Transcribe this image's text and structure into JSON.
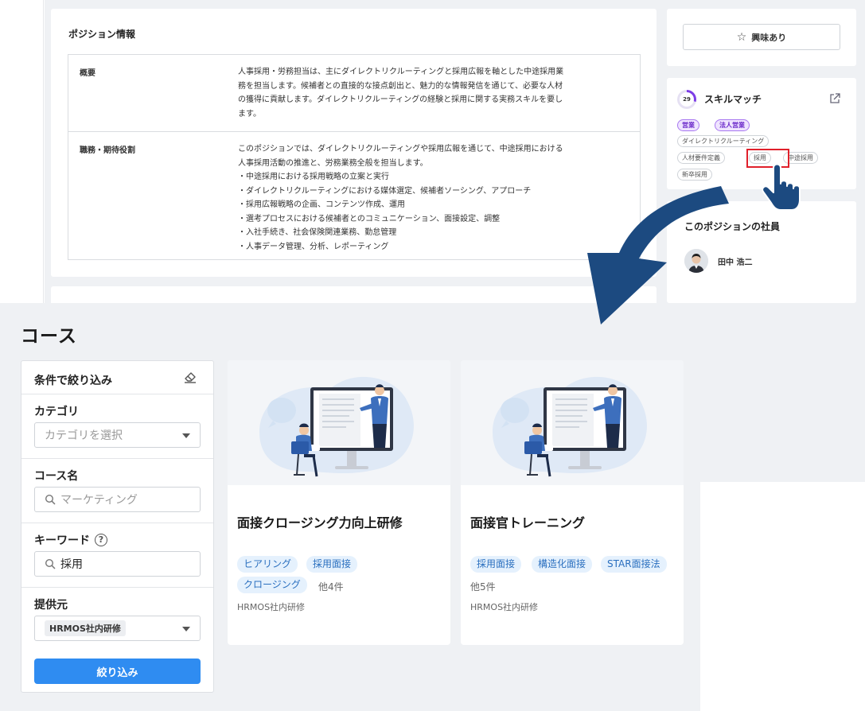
{
  "position": {
    "title": "ポジション情報",
    "rows": [
      {
        "label": "概要",
        "lines": [
          "人事採用・労務担当は、主にダイレクトリクルーティングと採用広報を軸とした中途採用業",
          "務を担当します。候補者との直接的な接点創出と、魅力的な情報発信を通じて、必要な人材",
          "の獲得に貢献します。ダイレクトリクルーティングの経験と採用に関する実務スキルを要し",
          "ます。"
        ]
      },
      {
        "label": "職務・期待役割",
        "lines": [
          "このポジションでは、ダイレクトリクルーティングや採用広報を通じて、中途採用における",
          "人事採用活動の推進と、労務業務全般を担当します。",
          "・中途採用における採用戦略の立案と実行",
          "・ダイレクトリクルーティングにおける媒体選定、候補者ソーシング、アプローチ",
          "・採用広報戦略の企画、コンテンツ作成、運用",
          "・選考プロセスにおける候補者とのコミュニケーション、面接設定、調整",
          "・入社手続き、社会保険関連業務、勤怠管理",
          "・人事データ管理、分析、レポーティング"
        ]
      }
    ]
  },
  "interest": {
    "label": "興味あり",
    "icon": "star-icon"
  },
  "skill_match": {
    "score": "29",
    "score_fraction": 0.29,
    "title": "スキルマッチ",
    "tags": [
      {
        "label": "営業",
        "highlight": true
      },
      {
        "label": "法人営業",
        "highlight": true
      },
      {
        "label": "ダイレクトリクルーティング",
        "highlight": false
      },
      {
        "label": "人材要件定義",
        "highlight": false
      },
      {
        "label": "採用",
        "highlight": false
      },
      {
        "label": "中途採用",
        "highlight": false
      },
      {
        "label": "新卒採用",
        "highlight": false
      }
    ]
  },
  "members": {
    "title": "このポジションの社員",
    "name": "田中 浩二"
  },
  "courses_page": {
    "title": "コース",
    "filter": {
      "header": "条件で絞り込み",
      "category_label": "カテゴリ",
      "category_placeholder": "カテゴリを選択",
      "course_name_label": "コース名",
      "course_name_placeholder": "マーケティング",
      "keyword_label": "キーワード",
      "keyword_value": "採用",
      "provider_label": "提供元",
      "provider_value": "HRMOS社内研修",
      "apply_label": "絞り込み"
    },
    "courses": [
      {
        "title": "面接クロージング力向上研修",
        "tags": [
          "ヒアリング",
          "採用面接",
          "クロージング"
        ],
        "more": "他4件",
        "provider": "HRMOS社内研修"
      },
      {
        "title": "面接官トレーニング",
        "tags": [
          "採用面接",
          "構造化面接",
          "STAR面接法"
        ],
        "more": "他5件",
        "provider": "HRMOS社内研修"
      }
    ]
  },
  "colors": {
    "accent": "#2f8cf1",
    "arrow": "#1c4a80",
    "highlight_box": "#e0202b",
    "skill_purple": "#7d3ee6"
  }
}
